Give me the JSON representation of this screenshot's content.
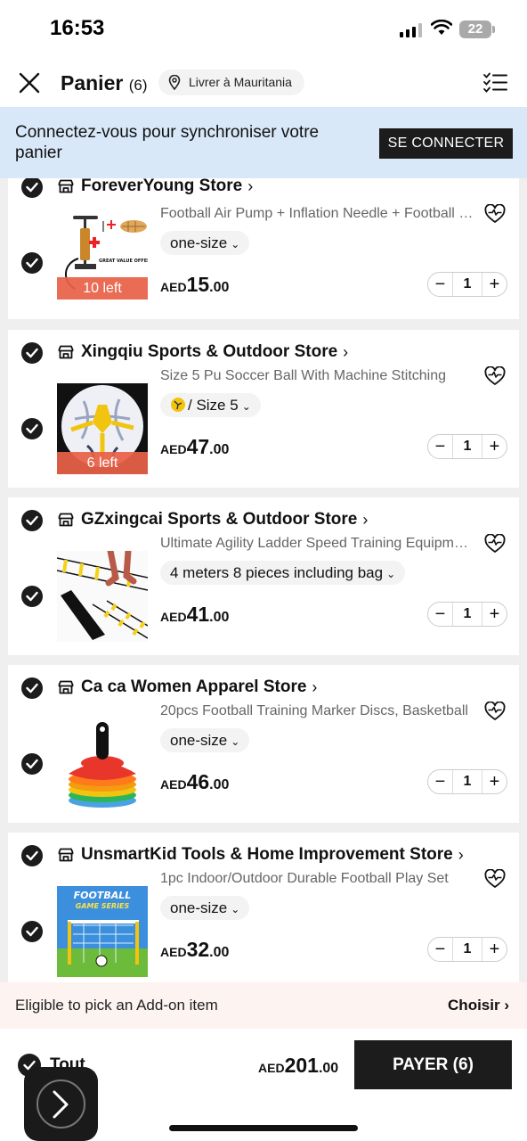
{
  "status_bar": {
    "time": "16:53",
    "battery": "22"
  },
  "header": {
    "title": "Panier",
    "count": "(6)",
    "ship_to": "Livrer à Mauritania"
  },
  "login_banner": {
    "message": "Connectez-vous pour synchroniser votre panier",
    "button": "SE CONNECTER"
  },
  "stores": [
    {
      "name": "ForeverYoung Store",
      "product": "Football Air Pump + Inflation Needle + Football Net Bag",
      "variant": "one-size",
      "stock_tag": "10 left",
      "currency": "AED",
      "price_int": "15",
      "price_dec": ".00",
      "quantity": "1"
    },
    {
      "name": "Xingqiu Sports & Outdoor Store",
      "product": "Size 5 Pu Soccer Ball With Machine Stitching",
      "variant": "/ Size 5",
      "stock_tag": "6 left",
      "currency": "AED",
      "price_int": "47",
      "price_dec": ".00",
      "quantity": "1"
    },
    {
      "name": "GZxingcai Sports & Outdoor Store",
      "product": "Ultimate Agility Ladder Speed Training Equipment",
      "variant": "4 meters 8 pieces including bag",
      "currency": "AED",
      "price_int": "41",
      "price_dec": ".00",
      "quantity": "1"
    },
    {
      "name": "Ca ca Women Apparel Store",
      "product": "20pcs Football Training Marker Discs, Basketball",
      "variant": "one-size",
      "currency": "AED",
      "price_int": "46",
      "price_dec": ".00",
      "quantity": "1"
    },
    {
      "name": "UnsmartKid Tools & Home Improvement Store",
      "product": "1pc Indoor/Outdoor Durable Football Play Set",
      "variant": "one-size",
      "image_text": "FOOTBALL GAME SERIES",
      "currency": "AED",
      "price_int": "32",
      "price_dec": ".00",
      "quantity": "1"
    }
  ],
  "addon": {
    "text": "Eligible to pick an Add-on item",
    "action": "Choisir"
  },
  "footer": {
    "select_all": "Tout",
    "currency": "AED",
    "total_int": "201",
    "total_dec": ".00",
    "pay_button": "PAYER (6)"
  },
  "colors": {
    "primary": "#1c1c1c",
    "banner_bg": "#d8e8f8",
    "stock_tag": "#e86147",
    "addon_bg": "#fdf3f1"
  }
}
